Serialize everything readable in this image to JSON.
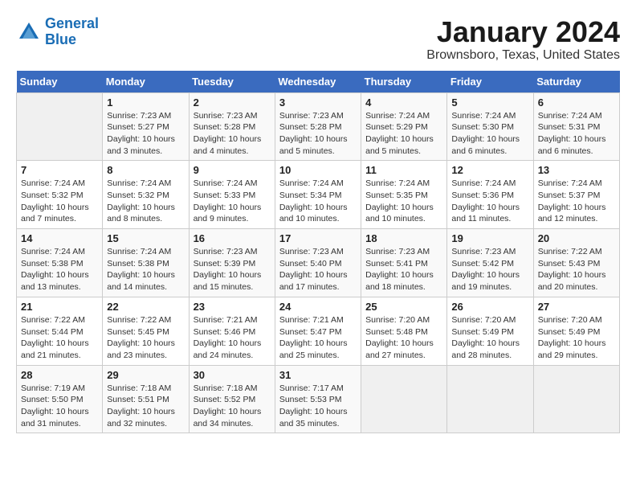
{
  "header": {
    "logo_line1": "General",
    "logo_line2": "Blue",
    "month_year": "January 2024",
    "location": "Brownsboro, Texas, United States"
  },
  "days_of_week": [
    "Sunday",
    "Monday",
    "Tuesday",
    "Wednesday",
    "Thursday",
    "Friday",
    "Saturday"
  ],
  "weeks": [
    [
      {
        "day": "",
        "info": ""
      },
      {
        "day": "1",
        "info": "Sunrise: 7:23 AM\nSunset: 5:27 PM\nDaylight: 10 hours\nand 3 minutes."
      },
      {
        "day": "2",
        "info": "Sunrise: 7:23 AM\nSunset: 5:28 PM\nDaylight: 10 hours\nand 4 minutes."
      },
      {
        "day": "3",
        "info": "Sunrise: 7:23 AM\nSunset: 5:28 PM\nDaylight: 10 hours\nand 5 minutes."
      },
      {
        "day": "4",
        "info": "Sunrise: 7:24 AM\nSunset: 5:29 PM\nDaylight: 10 hours\nand 5 minutes."
      },
      {
        "day": "5",
        "info": "Sunrise: 7:24 AM\nSunset: 5:30 PM\nDaylight: 10 hours\nand 6 minutes."
      },
      {
        "day": "6",
        "info": "Sunrise: 7:24 AM\nSunset: 5:31 PM\nDaylight: 10 hours\nand 6 minutes."
      }
    ],
    [
      {
        "day": "7",
        "info": "Sunrise: 7:24 AM\nSunset: 5:32 PM\nDaylight: 10 hours\nand 7 minutes."
      },
      {
        "day": "8",
        "info": "Sunrise: 7:24 AM\nSunset: 5:32 PM\nDaylight: 10 hours\nand 8 minutes."
      },
      {
        "day": "9",
        "info": "Sunrise: 7:24 AM\nSunset: 5:33 PM\nDaylight: 10 hours\nand 9 minutes."
      },
      {
        "day": "10",
        "info": "Sunrise: 7:24 AM\nSunset: 5:34 PM\nDaylight: 10 hours\nand 10 minutes."
      },
      {
        "day": "11",
        "info": "Sunrise: 7:24 AM\nSunset: 5:35 PM\nDaylight: 10 hours\nand 10 minutes."
      },
      {
        "day": "12",
        "info": "Sunrise: 7:24 AM\nSunset: 5:36 PM\nDaylight: 10 hours\nand 11 minutes."
      },
      {
        "day": "13",
        "info": "Sunrise: 7:24 AM\nSunset: 5:37 PM\nDaylight: 10 hours\nand 12 minutes."
      }
    ],
    [
      {
        "day": "14",
        "info": "Sunrise: 7:24 AM\nSunset: 5:38 PM\nDaylight: 10 hours\nand 13 minutes."
      },
      {
        "day": "15",
        "info": "Sunrise: 7:24 AM\nSunset: 5:38 PM\nDaylight: 10 hours\nand 14 minutes."
      },
      {
        "day": "16",
        "info": "Sunrise: 7:23 AM\nSunset: 5:39 PM\nDaylight: 10 hours\nand 15 minutes."
      },
      {
        "day": "17",
        "info": "Sunrise: 7:23 AM\nSunset: 5:40 PM\nDaylight: 10 hours\nand 17 minutes."
      },
      {
        "day": "18",
        "info": "Sunrise: 7:23 AM\nSunset: 5:41 PM\nDaylight: 10 hours\nand 18 minutes."
      },
      {
        "day": "19",
        "info": "Sunrise: 7:23 AM\nSunset: 5:42 PM\nDaylight: 10 hours\nand 19 minutes."
      },
      {
        "day": "20",
        "info": "Sunrise: 7:22 AM\nSunset: 5:43 PM\nDaylight: 10 hours\nand 20 minutes."
      }
    ],
    [
      {
        "day": "21",
        "info": "Sunrise: 7:22 AM\nSunset: 5:44 PM\nDaylight: 10 hours\nand 21 minutes."
      },
      {
        "day": "22",
        "info": "Sunrise: 7:22 AM\nSunset: 5:45 PM\nDaylight: 10 hours\nand 23 minutes."
      },
      {
        "day": "23",
        "info": "Sunrise: 7:21 AM\nSunset: 5:46 PM\nDaylight: 10 hours\nand 24 minutes."
      },
      {
        "day": "24",
        "info": "Sunrise: 7:21 AM\nSunset: 5:47 PM\nDaylight: 10 hours\nand 25 minutes."
      },
      {
        "day": "25",
        "info": "Sunrise: 7:20 AM\nSunset: 5:48 PM\nDaylight: 10 hours\nand 27 minutes."
      },
      {
        "day": "26",
        "info": "Sunrise: 7:20 AM\nSunset: 5:49 PM\nDaylight: 10 hours\nand 28 minutes."
      },
      {
        "day": "27",
        "info": "Sunrise: 7:20 AM\nSunset: 5:49 PM\nDaylight: 10 hours\nand 29 minutes."
      }
    ],
    [
      {
        "day": "28",
        "info": "Sunrise: 7:19 AM\nSunset: 5:50 PM\nDaylight: 10 hours\nand 31 minutes."
      },
      {
        "day": "29",
        "info": "Sunrise: 7:18 AM\nSunset: 5:51 PM\nDaylight: 10 hours\nand 32 minutes."
      },
      {
        "day": "30",
        "info": "Sunrise: 7:18 AM\nSunset: 5:52 PM\nDaylight: 10 hours\nand 34 minutes."
      },
      {
        "day": "31",
        "info": "Sunrise: 7:17 AM\nSunset: 5:53 PM\nDaylight: 10 hours\nand 35 minutes."
      },
      {
        "day": "",
        "info": ""
      },
      {
        "day": "",
        "info": ""
      },
      {
        "day": "",
        "info": ""
      }
    ]
  ]
}
